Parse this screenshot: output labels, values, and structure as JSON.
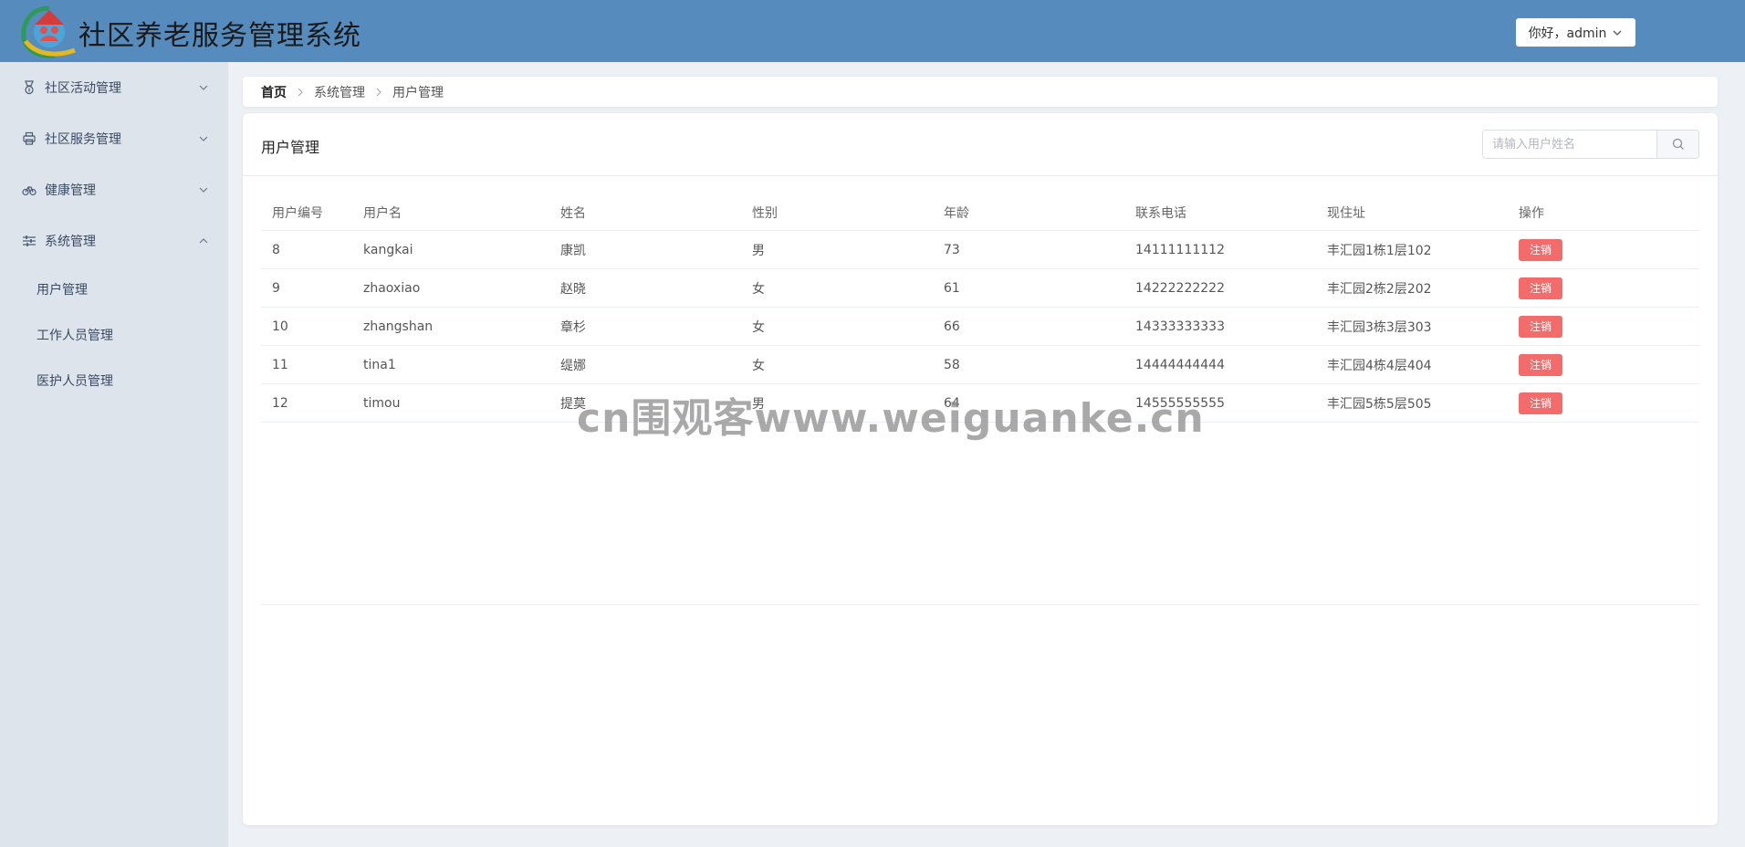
{
  "header": {
    "app_title": "社区养老服务管理系统",
    "user_greeting": "你好，admin",
    "bg_color": "#568cbd"
  },
  "sidebar": {
    "menus": [
      {
        "label": "社区活动管理",
        "icon": "medal-icon",
        "expanded": false
      },
      {
        "label": "社区服务管理",
        "icon": "printer-icon",
        "expanded": false
      },
      {
        "label": "健康管理",
        "icon": "bicycle-icon",
        "expanded": false
      },
      {
        "label": "系统管理",
        "icon": "sliders-icon",
        "expanded": true
      }
    ],
    "sub_items": [
      "用户管理",
      "工作人员管理",
      "医护人员管理"
    ]
  },
  "breadcrumb": [
    "首页",
    "系统管理",
    "用户管理"
  ],
  "main": {
    "title": "用户管理",
    "search_placeholder": "请输入用户姓名"
  },
  "table": {
    "headers": [
      "用户编号",
      "用户名",
      "姓名",
      "性别",
      "年龄",
      "联系电话",
      "现住址",
      "操作"
    ],
    "rows": [
      [
        "8",
        "kangkai",
        "康凯",
        "男",
        "73",
        "14111111112",
        "丰汇园1栋1层102",
        "注销"
      ],
      [
        "9",
        "zhaoxiao",
        "赵晓",
        "女",
        "61",
        "14222222222",
        "丰汇园2栋2层202",
        "注销"
      ],
      [
        "10",
        "zhangshan",
        "章杉",
        "女",
        "66",
        "14333333333",
        "丰汇园3栋3层303",
        "注销"
      ],
      [
        "11",
        "tina1",
        "缇娜",
        "女",
        "58",
        "14444444444",
        "丰汇园4栋4层404",
        "注销"
      ],
      [
        "12",
        "timou",
        "提莫",
        "男",
        "64",
        "14555555555",
        "丰汇园5栋5层505",
        "注销"
      ]
    ]
  },
  "watermark": "cn围观客www.weiguanke.cn",
  "colors": {
    "danger": "#f36b6b",
    "sidebar_bg": "#dde4ec"
  }
}
